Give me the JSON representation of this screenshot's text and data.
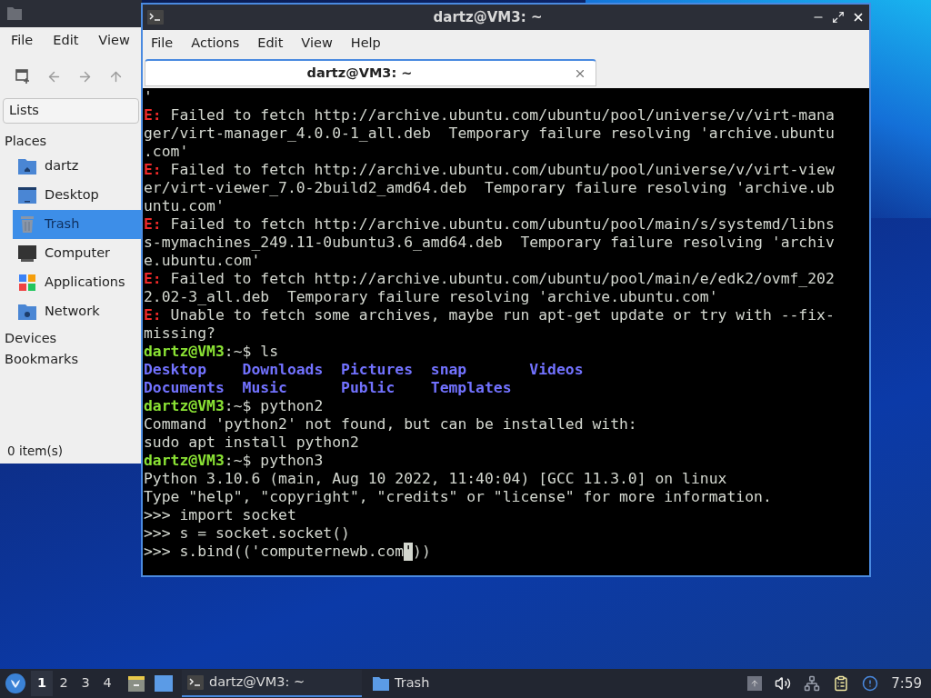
{
  "file_manager": {
    "menu": [
      "File",
      "Edit",
      "View"
    ],
    "location": "Lists",
    "places_heading": "Places",
    "places": [
      {
        "label": "dartz",
        "kind": "home",
        "selected": false
      },
      {
        "label": "Desktop",
        "kind": "desktop",
        "selected": false
      },
      {
        "label": "Trash",
        "kind": "trash",
        "selected": true
      },
      {
        "label": "Computer",
        "kind": "computer",
        "selected": false
      },
      {
        "label": "Applications",
        "kind": "apps",
        "selected": false
      },
      {
        "label": "Network",
        "kind": "network",
        "selected": false
      }
    ],
    "sections": [
      "Devices",
      "Bookmarks"
    ],
    "status": "0 item(s)"
  },
  "terminal": {
    "title": "dartz@VM3: ~",
    "menu": [
      "File",
      "Actions",
      "Edit",
      "View",
      "Help"
    ],
    "tabs": [
      {
        "label": "dartz@VM3: ~",
        "selected": true
      }
    ],
    "lines": [
      {
        "kind": "plain",
        "text": "'"
      },
      {
        "kind": "error",
        "tag": "E:",
        "text": "Failed to fetch http://archive.ubuntu.com/ubuntu/pool/universe/v/virt-mana"
      },
      {
        "kind": "plain",
        "text": "ger/virt-manager_4.0.0-1_all.deb  Temporary failure resolving 'archive.ubuntu"
      },
      {
        "kind": "plain",
        "text": ".com'"
      },
      {
        "kind": "error",
        "tag": "E:",
        "text": "Failed to fetch http://archive.ubuntu.com/ubuntu/pool/universe/v/virt-view"
      },
      {
        "kind": "plain",
        "text": "er/virt-viewer_7.0-2build2_amd64.deb  Temporary failure resolving 'archive.ub"
      },
      {
        "kind": "plain",
        "text": "untu.com'"
      },
      {
        "kind": "error",
        "tag": "E:",
        "text": "Failed to fetch http://archive.ubuntu.com/ubuntu/pool/main/s/systemd/libns"
      },
      {
        "kind": "plain",
        "text": "s-mymachines_249.11-0ubuntu3.6_amd64.deb  Temporary failure resolving 'archiv"
      },
      {
        "kind": "plain",
        "text": "e.ubuntu.com'"
      },
      {
        "kind": "error",
        "tag": "E:",
        "text": "Failed to fetch http://archive.ubuntu.com/ubuntu/pool/main/e/edk2/ovmf_202"
      },
      {
        "kind": "plain",
        "text": "2.02-3_all.deb  Temporary failure resolving 'archive.ubuntu.com'"
      },
      {
        "kind": "error",
        "tag": "E:",
        "text": "Unable to fetch some archives, maybe run apt-get update or try with --fix-"
      },
      {
        "kind": "plain",
        "text": "missing?"
      },
      {
        "kind": "prompt",
        "user": "dartz@VM3",
        "path": ":~$",
        "text": "ls"
      },
      {
        "kind": "columns",
        "entries": [
          "Desktop",
          "Downloads",
          "Pictures",
          "snap",
          "Videos"
        ]
      },
      {
        "kind": "columns",
        "entries": [
          "Documents",
          "Music",
          "Public",
          "Templates"
        ]
      },
      {
        "kind": "prompt",
        "user": "dartz@VM3",
        "path": ":~$",
        "text": "python2"
      },
      {
        "kind": "plain",
        "text": "Command 'python2' not found, but can be installed with:"
      },
      {
        "kind": "plain",
        "text": "sudo apt install python2"
      },
      {
        "kind": "prompt",
        "user": "dartz@VM3",
        "path": ":~$",
        "text": "python3"
      },
      {
        "kind": "plain",
        "text": "Python 3.10.6 (main, Aug 10 2022, 11:40:04) [GCC 11.3.0] on linux"
      },
      {
        "kind": "plain",
        "text": "Type \"help\", \"copyright\", \"credits\" or \"license\" for more information."
      },
      {
        "kind": "plain",
        "text": ">>> import socket"
      },
      {
        "kind": "plain",
        "text": ">>> s = socket.socket()"
      },
      {
        "kind": "cursor_line",
        "before": ">>> s.bind(('computernewb.com",
        "cursor": "'",
        "after": "))"
      }
    ]
  },
  "taskbar": {
    "workspaces": [
      {
        "label": "1",
        "selected": true
      },
      {
        "label": "2",
        "selected": false
      },
      {
        "label": "3",
        "selected": false
      },
      {
        "label": "4",
        "selected": false
      }
    ],
    "tasks": [
      {
        "label": "dartz@VM3: ~",
        "kind": "terminal",
        "selected": true
      },
      {
        "label": "Trash",
        "kind": "folder",
        "selected": false
      }
    ],
    "clock": "7:59"
  }
}
